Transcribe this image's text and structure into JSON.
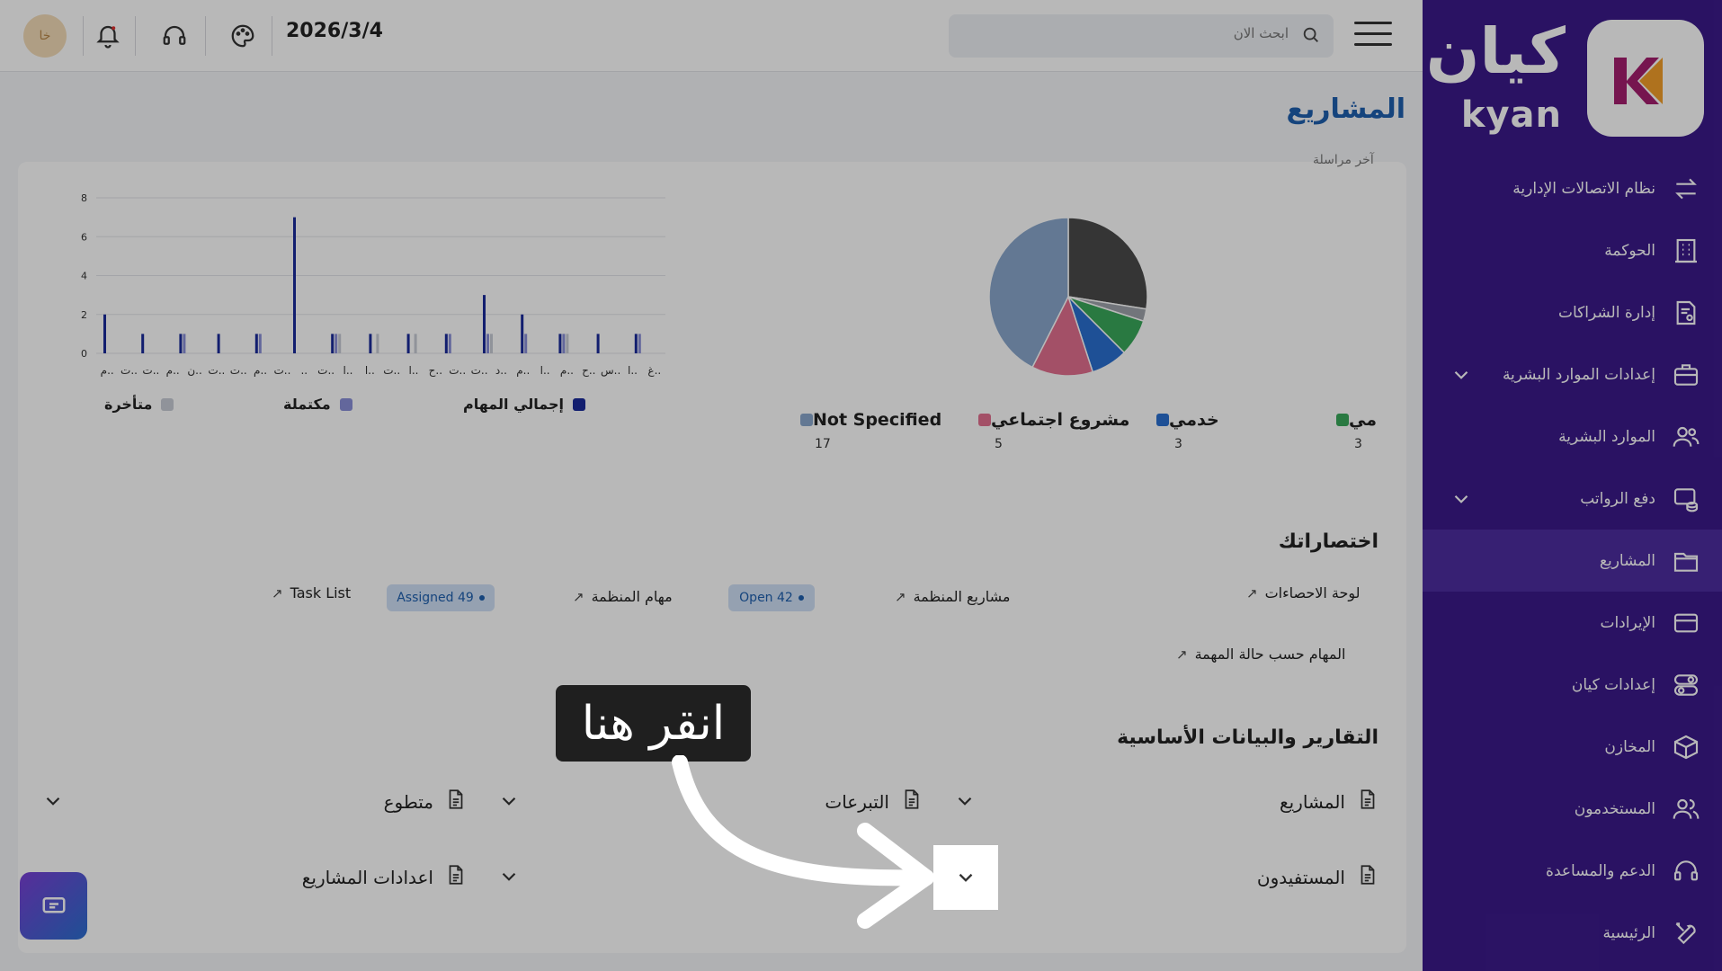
{
  "brand": {
    "name_ar": "كيان",
    "name_en": "kyan"
  },
  "topbar": {
    "date": "2026/3/4",
    "search_placeholder": "ابحث الان",
    "avatar_initials": "خا"
  },
  "page": {
    "title": "المشاريع",
    "cut_title": "آخر مراسلة"
  },
  "sidebar": {
    "items": [
      {
        "label": "نظام الاتصالات الإدارية",
        "icon": "arrows-exchange-icon"
      },
      {
        "label": "الحوكمة",
        "icon": "building-icon"
      },
      {
        "label": "إدارة الشراكات",
        "icon": "document-user-icon"
      },
      {
        "label": "إعدادات الموارد البشرية",
        "icon": "briefcase-icon",
        "expandable": true
      },
      {
        "label": "الموارد البشرية",
        "icon": "users-icon"
      },
      {
        "label": "دفع الرواتب",
        "icon": "payroll-icon",
        "expandable": true
      },
      {
        "label": "المشاريع",
        "icon": "folder-icon",
        "active": true
      },
      {
        "label": "الإيرادات",
        "icon": "card-icon"
      },
      {
        "label": "إعدادات كيان",
        "icon": "toggles-icon"
      },
      {
        "label": "المخازن",
        "icon": "box-icon"
      },
      {
        "label": "المستخدمون",
        "icon": "user-group-icon"
      },
      {
        "label": "الدعم والمساعدة",
        "icon": "headset-icon"
      },
      {
        "label": "الرئيسية",
        "icon": "tools-icon"
      }
    ]
  },
  "bar_chart": {
    "legend": {
      "total": "إجمالي المهام",
      "completed": "مكتملة",
      "late": "متأخرة"
    },
    "colors": {
      "total": "#1a2a9a",
      "completed": "#8a8fd8",
      "late": "#c8ccd6"
    }
  },
  "chart_data": [
    {
      "type": "bar",
      "categories": [
        "م..",
        "ت..",
        "ت..",
        "م..",
        "ن..",
        "ت..",
        "ت..",
        "م..",
        "ت..",
        "..",
        "ت..",
        "ا..",
        "ا..",
        "ت..",
        "ا..",
        "ح..",
        "ت..",
        "ت..",
        "د..",
        "م..",
        "ا..",
        "م..",
        "ح..",
        "س..",
        "ا..",
        "غ.."
      ],
      "series": [
        {
          "name": "إجمالي المهام",
          "values": [
            2,
            1,
            1,
            1,
            1,
            7,
            1,
            1,
            1,
            1,
            3,
            2,
            1,
            1,
            1
          ]
        },
        {
          "name": "مكتملة",
          "values": [
            0,
            0,
            1,
            0,
            1,
            0,
            1,
            0,
            0,
            1,
            1,
            1,
            1,
            0,
            1
          ]
        },
        {
          "name": "متأخرة",
          "values": [
            0,
            0,
            0,
            0,
            0,
            0,
            1,
            1,
            1,
            0,
            1,
            0,
            1,
            0,
            0
          ]
        }
      ],
      "ylim": [
        0,
        8
      ],
      "yticks": [
        "0",
        "2",
        "4",
        "6",
        "8"
      ]
    },
    {
      "type": "pie",
      "slices": [
        {
          "label": "Not Specified",
          "value": 17,
          "color": "#8aa7cc"
        },
        {
          "label": "مشروع اجتماعي",
          "value": 5,
          "color": "#e2708f"
        },
        {
          "label": "خدمي",
          "value": 3,
          "color": "#2a6fd0"
        },
        {
          "label": "مي",
          "value": 3,
          "color": "#3aa85a"
        },
        {
          "label": "",
          "value": 1,
          "color": "#9ea3ab"
        },
        {
          "label": "",
          "value": 11,
          "color": "#4a4a4a"
        }
      ],
      "legend": [
        {
          "label": "Not Specified",
          "count": "17",
          "color": "#8aa7cc"
        },
        {
          "label": "مشروع اجتماعي",
          "count": "5",
          "color": "#e2708f"
        },
        {
          "label": "خدمي",
          "count": "3",
          "color": "#2a6fd0"
        },
        {
          "label": "مي",
          "count": "3",
          "color": "#3aa85a"
        }
      ]
    }
  ],
  "shortcuts": {
    "title": "اختصاراتك",
    "items": [
      {
        "label": "لوحة الاحصاءات"
      },
      {
        "label": "مشاريع المنظمة"
      },
      {
        "label": "مهام المنظمة",
        "badge": "Open 42"
      },
      {
        "label": "Task List",
        "badge": "Assigned 49"
      },
      {
        "label": "المهام حسب حالة المهمة"
      }
    ]
  },
  "reports": {
    "title": "التقارير والبيانات الأساسية",
    "items": [
      {
        "label": "المشاريع"
      },
      {
        "label": "التبرعات"
      },
      {
        "label": "متطوع"
      },
      {
        "label": "المستفيدون"
      },
      {
        "label": "اعدادات المشاريع"
      }
    ]
  },
  "tutorial": {
    "tooltip": "انقر هنا"
  }
}
